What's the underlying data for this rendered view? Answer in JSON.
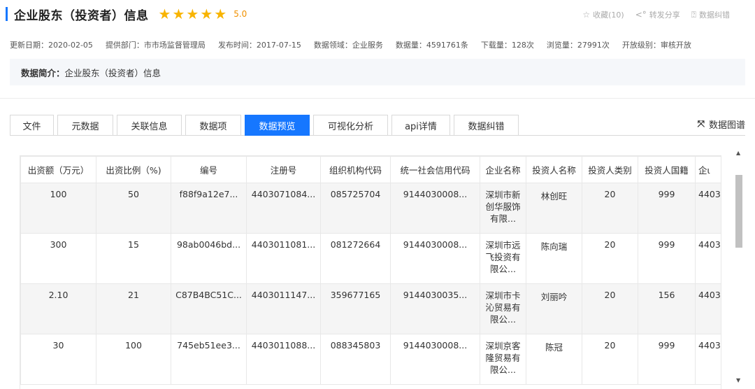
{
  "header": {
    "title": "企业股东（投资者）信息",
    "rating": "5.0",
    "stars": 5,
    "actions": {
      "favorite": "收藏(10)",
      "share": "转发分享",
      "correction": "数据纠错"
    }
  },
  "meta": {
    "updated": "更新日期：2020-02-05",
    "department": "提供部门：市市场监督管理局",
    "published": "发布时间：2017-07-15",
    "domain": "数据领域：企业服务",
    "count": "数据量：4591761条",
    "downloads": "下载量：128次",
    "views": "浏览量：27991次",
    "open_level": "开放级别：审核开放"
  },
  "intro": {
    "label": "数据简介：",
    "text": "企业股东（投资者）信息"
  },
  "tabs": [
    "文件",
    "元数据",
    "关联信息",
    "数据项",
    "数据预览",
    "可视化分析",
    "api详情",
    "数据纠错"
  ],
  "active_tab": "数据预览",
  "datamap_label": "数据图谱",
  "table": {
    "headers": [
      "出资额（万元）",
      "出资比例（%)",
      "编号",
      "注册号",
      "组织机构代码",
      "统一社会信用代码",
      "企业名称",
      "投资人名称",
      "投资人类别",
      "投资人国籍",
      "企ɩ"
    ],
    "rows": [
      [
        "100",
        "50",
        "f88f9a12e7...",
        "4403071084...",
        "085725704",
        "9144030008...",
        "深圳市新创华服饰有限...",
        "林创旺",
        "20",
        "999",
        "4403("
      ],
      [
        "300",
        "15",
        "98ab0046bd...",
        "4403011081...",
        "081272664",
        "9144030008...",
        "深圳市远飞投资有限公...",
        "陈向瑞",
        "20",
        "999",
        "4403("
      ],
      [
        "2.10",
        "21",
        "C87B4BC51C...",
        "4403011147...",
        "359677165",
        "9144030035...",
        "深圳市卡沁贸易有限公...",
        "刘丽吟",
        "20",
        "156",
        "4403("
      ],
      [
        "30",
        "100",
        "745eb51ee3...",
        "4403011088...",
        "088345803",
        "9144030008...",
        "深圳京客隆贸易有限公...",
        "陈冠",
        "20",
        "999",
        "4403("
      ]
    ]
  },
  "colors": {
    "accent": "#1677ff",
    "star": "#f8b400",
    "rating": "#f09000"
  }
}
